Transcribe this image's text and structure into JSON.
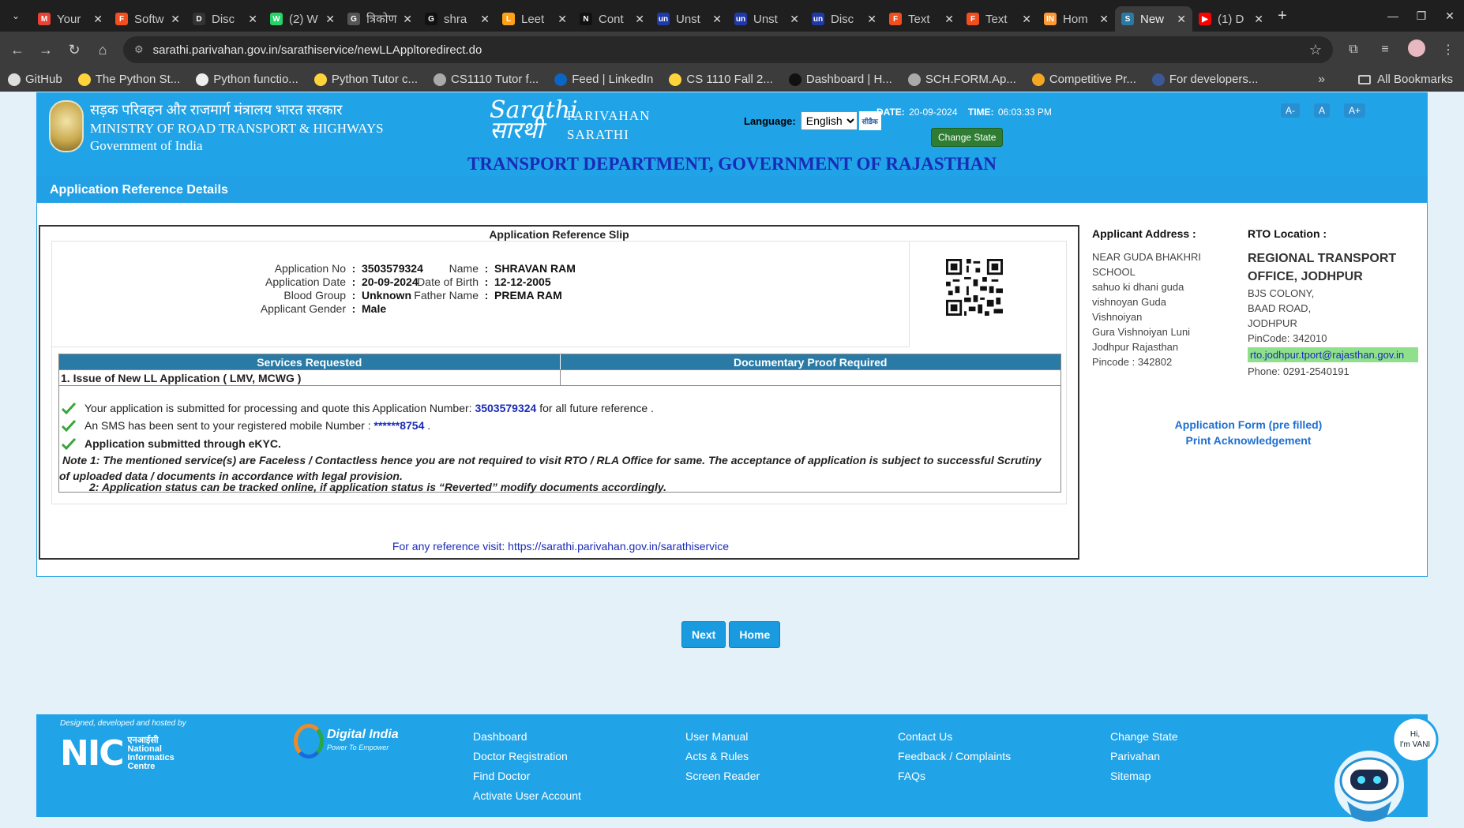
{
  "tabs": [
    {
      "title": "Your",
      "fav": "M",
      "color": "#ea4335"
    },
    {
      "title": "Softw",
      "fav": "F",
      "color": "#f24e1e"
    },
    {
      "title": "Disc",
      "fav": "D",
      "color": "#333"
    },
    {
      "title": "(2) W",
      "fav": "W",
      "color": "#25d366"
    },
    {
      "title": "त्रिकोण",
      "fav": "G",
      "color": "#555"
    },
    {
      "title": "shra",
      "fav": "G",
      "color": "#111"
    },
    {
      "title": "Leet",
      "fav": "L",
      "color": "#ffa116"
    },
    {
      "title": "Cont",
      "fav": "N",
      "color": "#111"
    },
    {
      "title": "Unst",
      "fav": "un",
      "color": "#1f3aa8"
    },
    {
      "title": "Unst",
      "fav": "un",
      "color": "#1f3aa8"
    },
    {
      "title": "Disc",
      "fav": "un",
      "color": "#1f3aa8"
    },
    {
      "title": "Text",
      "fav": "F",
      "color": "#f24e1e"
    },
    {
      "title": "Text",
      "fav": "F",
      "color": "#f24e1e"
    },
    {
      "title": "Hom",
      "fav": "IN",
      "color": "#ff9933"
    },
    {
      "title": "New",
      "fav": "S",
      "color": "#2a7aa6",
      "active": true
    },
    {
      "title": "(1) D",
      "fav": "▶",
      "color": "#ff0000"
    }
  ],
  "address": {
    "url": "sarathi.parivahan.gov.in/sarathiservice/newLLAppltoredirect.do"
  },
  "bookmarks": [
    {
      "label": "GitHub",
      "color": "#ddd"
    },
    {
      "label": "The Python St...",
      "color": "#ffd43b"
    },
    {
      "label": "Python functio...",
      "color": "#eee"
    },
    {
      "label": "Python Tutor c...",
      "color": "#ffd43b"
    },
    {
      "label": "CS1110 Tutor f...",
      "color": "#aaa"
    },
    {
      "label": "Feed | LinkedIn",
      "color": "#0a66c2"
    },
    {
      "label": "CS 1110 Fall 2...",
      "color": "#ffd43b"
    },
    {
      "label": "Dashboard | H...",
      "color": "#111"
    },
    {
      "label": "SCH.FORM.Ap...",
      "color": "#aaa"
    },
    {
      "label": "Competitive Pr...",
      "color": "#f5a623"
    },
    {
      "label": "For developers...",
      "color": "#3b5998"
    }
  ],
  "bookmarks_more": "»",
  "all_bookmarks": "All Bookmarks",
  "header": {
    "ministry_hi": "सड़क परिवहन और राजमार्ग मंत्रालय भारत सरकार",
    "ministry_en": "MINISTRY OF ROAD TRANSPORT & HIGHWAYS",
    "govt": "Government of India",
    "sarathi_logo": "Sarathi सारथी",
    "parivahan": "PARIVAHAN",
    "sarathi": "SARATHI",
    "date_label": "DATE:",
    "date": "20-09-2024",
    "time_label": "TIME:",
    "time": "06:03:33 PM",
    "language_label": "Language:",
    "language_value": "English",
    "cdac": "सीडैक",
    "change_state": "Change State",
    "font_small": "A-",
    "font_normal": "A",
    "font_large": "A+"
  },
  "dept_title": "TRANSPORT DEPARTMENT, GOVERNMENT OF RAJASTHAN",
  "panel_title": "Application Reference Details",
  "slip": {
    "title": "Application Reference Slip",
    "app_no_label": "Application No",
    "app_no": "3503579324",
    "app_date_label": "Application Date",
    "app_date": "20-09-2024",
    "blood_label": "Blood Group",
    "blood": "Unknown",
    "gender_label": "Applicant Gender",
    "gender": "Male",
    "name_label": "Name",
    "name": "SHRAVAN RAM",
    "dob_label": "Date of Birth",
    "dob": "12-12-2005",
    "father_label": "Father Name",
    "father": "PREMA RAM",
    "services_header": "Services Requested",
    "proof_header": "Documentary Proof Required",
    "service_1": "1. Issue of New LL Application ( LMV, MCWG )",
    "msg1_pre": "Your application is submitted for processing and quote this Application Number:",
    "msg1_num": "3503579324",
    "msg1_post": "for all future reference .",
    "msg2_pre": "An SMS has been sent to your registered mobile Number :",
    "msg2_num": "******8754",
    "msg2_post": ".",
    "msg3": "Application submitted through eKYC.",
    "note1a": "Note 1:  The mentioned service(s) are Faceless / Contactless hence you are not required to visit RTO / RLA Office for same. The acceptance of application is subject to successful Scrutiny",
    "note1b": "of uploaded data / documents in accordance with legal provision.",
    "note2": "2:  Application status can be tracked online, if application status is “Reverted” modify documents accordingly.",
    "ref_visit": "For any reference visit: https://sarathi.parivahan.gov.in/sarathiservice"
  },
  "applicant_address": {
    "heading": "Applicant Address :",
    "lines": [
      "NEAR GUDA BHAKHRI",
      "SCHOOL",
      "sahuo ki dhani guda",
      "vishnoyan Guda",
      "Vishnoiyan",
      "Gura Vishnoiyan Luni",
      "Jodhpur Rajasthan",
      "Pincode : 342802"
    ]
  },
  "rto": {
    "heading": "RTO Location :",
    "office_1": "REGIONAL TRANSPORT",
    "office_2": "OFFICE, JODHPUR",
    "lines": [
      "BJS COLONY,",
      "BAAD ROAD,",
      "JODHPUR",
      "PinCode:  342010"
    ],
    "email": "rto.jodhpur.tport@rajasthan.gov.in",
    "phone": "Phone:  0291-2540191"
  },
  "links": {
    "form": "Application Form (pre filled)",
    "print": "Print Acknowledgement"
  },
  "buttons": {
    "next": "Next",
    "home": "Home"
  },
  "footer": {
    "designed": "Designed, developed and hosted by",
    "nic_big": "NIC",
    "nic_hi": "एनआईसी",
    "nic_1": "National",
    "nic_2": "Informatics",
    "nic_3": "Centre",
    "digital_india": "Digital India",
    "digital_tag": "Power To Empower",
    "col1": [
      "Dashboard",
      "Doctor Registration",
      "Find Doctor",
      "Activate User Account"
    ],
    "col2": [
      "User Manual",
      "Acts & Rules",
      "Screen Reader"
    ],
    "col3": [
      "Contact Us",
      "Feedback / Complaints",
      "FAQs"
    ],
    "col4": [
      "Change State",
      "Parivahan",
      "Sitemap"
    ],
    "vani_1": "Hi,",
    "vani_2": "I'm VANI"
  }
}
